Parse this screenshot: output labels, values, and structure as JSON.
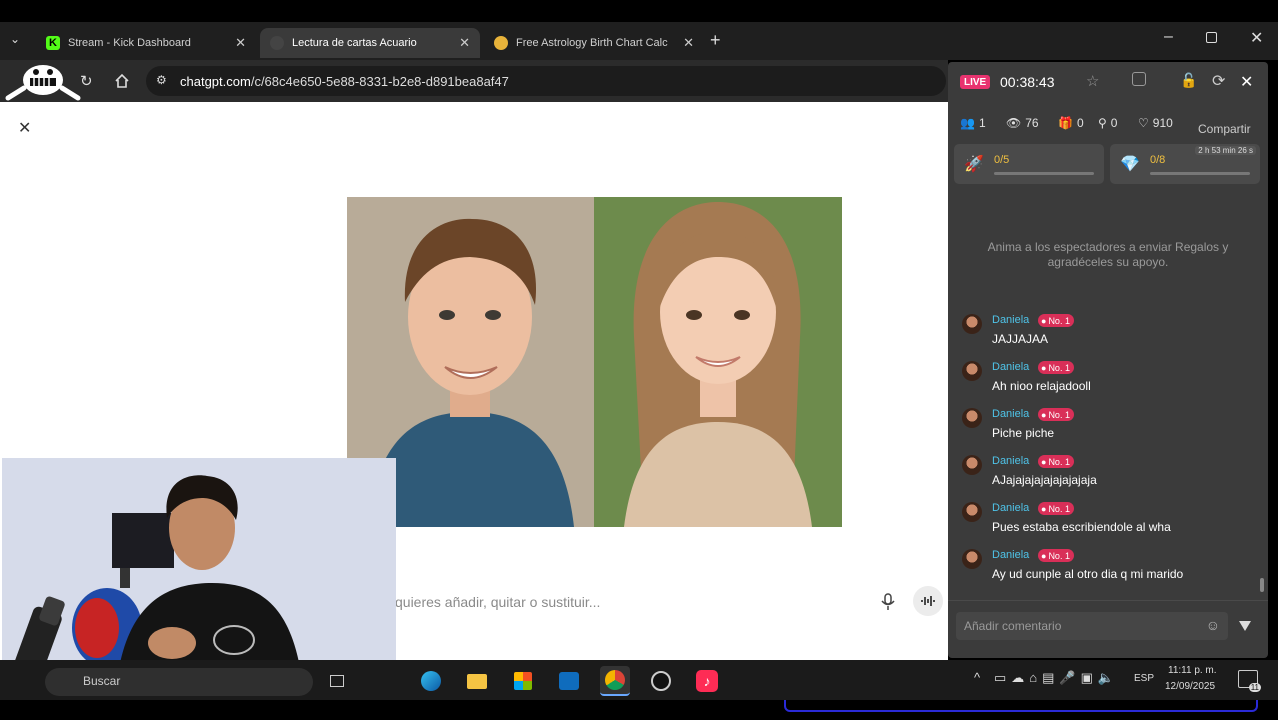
{
  "browser": {
    "tabs": [
      {
        "label": "Stream - Kick Dashboard",
        "active": false
      },
      {
        "label": "Lectura de cartas Acuario",
        "active": true
      },
      {
        "label": "Free Astrology Birth Chart Calc",
        "active": false
      }
    ],
    "url_domain": "chatgpt.com",
    "url_path": "/c/68c4e650-5e88-8331-b2e8-d891bea8af47"
  },
  "chatgpt": {
    "input_placeholder": "quieres añadir, quitar o sustituir..."
  },
  "live_panel": {
    "live_badge": "LIVE",
    "timer": "00:38:43",
    "stats": {
      "users": "1",
      "views": "76",
      "gifts": "0",
      "shares": "0",
      "likes": "910"
    },
    "share_label": "Compartir",
    "goal_1": "0/5",
    "goal_2": "0/8",
    "goal_2_timer": "2 h 53 min 26 s",
    "gift_prompt": "Anima a los espectadores a enviar Regalos y agradéceles su apoyo.",
    "comments": [
      {
        "name": "Daniela",
        "badge": "No. 1",
        "text": "JAJJAJAA"
      },
      {
        "name": "Daniela",
        "badge": "No. 1",
        "text": "Ah nioo relajadooll"
      },
      {
        "name": "Daniela",
        "badge": "No. 1",
        "text": "Piche piche"
      },
      {
        "name": "Daniela",
        "badge": "No. 1",
        "text": "AJajajajajajajajajaja"
      },
      {
        "name": "Daniela",
        "badge": "No. 1",
        "text": "Pues estaba escribiendole al wha"
      },
      {
        "name": "Daniela",
        "badge": "No. 1",
        "text": "Ay ud cunple al otro dia q mi marido"
      }
    ],
    "comment_placeholder": "Añadir comentario"
  },
  "taskbar": {
    "search_label": "Buscar",
    "language": "ESP",
    "time": "11:11 p. m.",
    "date": "12/09/2025",
    "notifications": "11"
  }
}
